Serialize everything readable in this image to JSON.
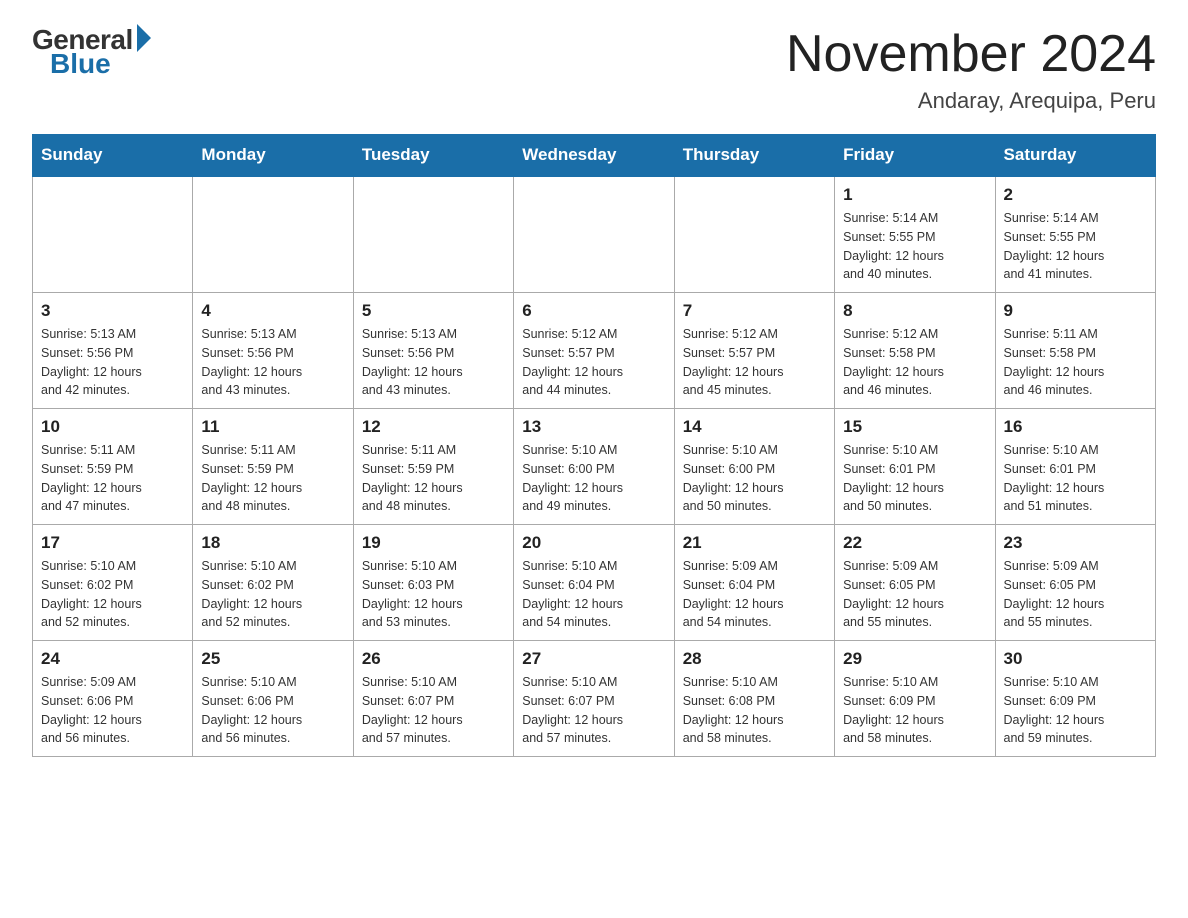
{
  "header": {
    "logo_general": "General",
    "logo_blue": "Blue",
    "month_title": "November 2024",
    "location": "Andaray, Arequipa, Peru"
  },
  "days_of_week": [
    "Sunday",
    "Monday",
    "Tuesday",
    "Wednesday",
    "Thursday",
    "Friday",
    "Saturday"
  ],
  "weeks": [
    {
      "days": [
        {
          "number": "",
          "info": ""
        },
        {
          "number": "",
          "info": ""
        },
        {
          "number": "",
          "info": ""
        },
        {
          "number": "",
          "info": ""
        },
        {
          "number": "",
          "info": ""
        },
        {
          "number": "1",
          "info": "Sunrise: 5:14 AM\nSunset: 5:55 PM\nDaylight: 12 hours\nand 40 minutes."
        },
        {
          "number": "2",
          "info": "Sunrise: 5:14 AM\nSunset: 5:55 PM\nDaylight: 12 hours\nand 41 minutes."
        }
      ]
    },
    {
      "days": [
        {
          "number": "3",
          "info": "Sunrise: 5:13 AM\nSunset: 5:56 PM\nDaylight: 12 hours\nand 42 minutes."
        },
        {
          "number": "4",
          "info": "Sunrise: 5:13 AM\nSunset: 5:56 PM\nDaylight: 12 hours\nand 43 minutes."
        },
        {
          "number": "5",
          "info": "Sunrise: 5:13 AM\nSunset: 5:56 PM\nDaylight: 12 hours\nand 43 minutes."
        },
        {
          "number": "6",
          "info": "Sunrise: 5:12 AM\nSunset: 5:57 PM\nDaylight: 12 hours\nand 44 minutes."
        },
        {
          "number": "7",
          "info": "Sunrise: 5:12 AM\nSunset: 5:57 PM\nDaylight: 12 hours\nand 45 minutes."
        },
        {
          "number": "8",
          "info": "Sunrise: 5:12 AM\nSunset: 5:58 PM\nDaylight: 12 hours\nand 46 minutes."
        },
        {
          "number": "9",
          "info": "Sunrise: 5:11 AM\nSunset: 5:58 PM\nDaylight: 12 hours\nand 46 minutes."
        }
      ]
    },
    {
      "days": [
        {
          "number": "10",
          "info": "Sunrise: 5:11 AM\nSunset: 5:59 PM\nDaylight: 12 hours\nand 47 minutes."
        },
        {
          "number": "11",
          "info": "Sunrise: 5:11 AM\nSunset: 5:59 PM\nDaylight: 12 hours\nand 48 minutes."
        },
        {
          "number": "12",
          "info": "Sunrise: 5:11 AM\nSunset: 5:59 PM\nDaylight: 12 hours\nand 48 minutes."
        },
        {
          "number": "13",
          "info": "Sunrise: 5:10 AM\nSunset: 6:00 PM\nDaylight: 12 hours\nand 49 minutes."
        },
        {
          "number": "14",
          "info": "Sunrise: 5:10 AM\nSunset: 6:00 PM\nDaylight: 12 hours\nand 50 minutes."
        },
        {
          "number": "15",
          "info": "Sunrise: 5:10 AM\nSunset: 6:01 PM\nDaylight: 12 hours\nand 50 minutes."
        },
        {
          "number": "16",
          "info": "Sunrise: 5:10 AM\nSunset: 6:01 PM\nDaylight: 12 hours\nand 51 minutes."
        }
      ]
    },
    {
      "days": [
        {
          "number": "17",
          "info": "Sunrise: 5:10 AM\nSunset: 6:02 PM\nDaylight: 12 hours\nand 52 minutes."
        },
        {
          "number": "18",
          "info": "Sunrise: 5:10 AM\nSunset: 6:02 PM\nDaylight: 12 hours\nand 52 minutes."
        },
        {
          "number": "19",
          "info": "Sunrise: 5:10 AM\nSunset: 6:03 PM\nDaylight: 12 hours\nand 53 minutes."
        },
        {
          "number": "20",
          "info": "Sunrise: 5:10 AM\nSunset: 6:04 PM\nDaylight: 12 hours\nand 54 minutes."
        },
        {
          "number": "21",
          "info": "Sunrise: 5:09 AM\nSunset: 6:04 PM\nDaylight: 12 hours\nand 54 minutes."
        },
        {
          "number": "22",
          "info": "Sunrise: 5:09 AM\nSunset: 6:05 PM\nDaylight: 12 hours\nand 55 minutes."
        },
        {
          "number": "23",
          "info": "Sunrise: 5:09 AM\nSunset: 6:05 PM\nDaylight: 12 hours\nand 55 minutes."
        }
      ]
    },
    {
      "days": [
        {
          "number": "24",
          "info": "Sunrise: 5:09 AM\nSunset: 6:06 PM\nDaylight: 12 hours\nand 56 minutes."
        },
        {
          "number": "25",
          "info": "Sunrise: 5:10 AM\nSunset: 6:06 PM\nDaylight: 12 hours\nand 56 minutes."
        },
        {
          "number": "26",
          "info": "Sunrise: 5:10 AM\nSunset: 6:07 PM\nDaylight: 12 hours\nand 57 minutes."
        },
        {
          "number": "27",
          "info": "Sunrise: 5:10 AM\nSunset: 6:07 PM\nDaylight: 12 hours\nand 57 minutes."
        },
        {
          "number": "28",
          "info": "Sunrise: 5:10 AM\nSunset: 6:08 PM\nDaylight: 12 hours\nand 58 minutes."
        },
        {
          "number": "29",
          "info": "Sunrise: 5:10 AM\nSunset: 6:09 PM\nDaylight: 12 hours\nand 58 minutes."
        },
        {
          "number": "30",
          "info": "Sunrise: 5:10 AM\nSunset: 6:09 PM\nDaylight: 12 hours\nand 59 minutes."
        }
      ]
    }
  ]
}
